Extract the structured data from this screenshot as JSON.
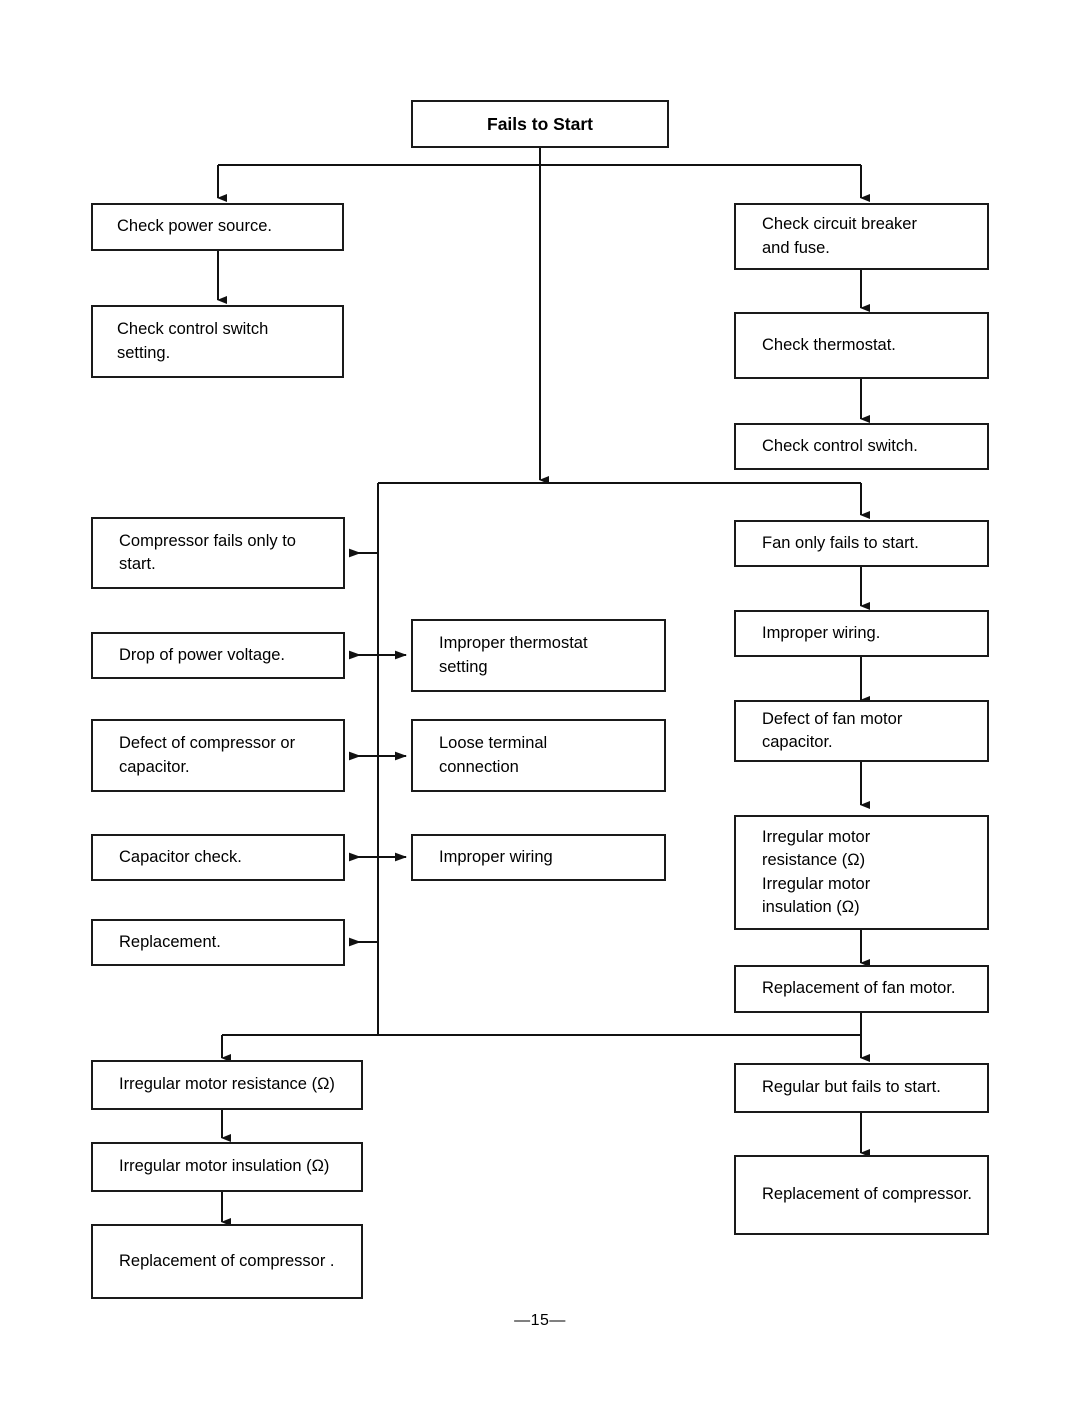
{
  "page": {
    "title": "Fails to Start",
    "page_number": "—15—",
    "line_color": "#1a1a1a",
    "box_border_color": "#1a1a1a",
    "background": "#ffffff",
    "text_color": "#000000"
  },
  "flowchart": {
    "root": {
      "id": "fails-to-start",
      "label": "Fails to Start"
    },
    "nodes": [
      {
        "id": "check-power-source",
        "label": "Check  power source."
      },
      {
        "id": "check-control-switch-setting",
        "label": "Check  control switch\nsetting."
      },
      {
        "id": "check-circuit-breaker-fuse",
        "label": "Check  circuit breaker\nand fuse."
      },
      {
        "id": "check-thermostat",
        "label": "Check  thermostat."
      },
      {
        "id": "check-control-switch",
        "label": "Check control switch."
      },
      {
        "id": "compressor-fails-only-to-start",
        "label": "Compressor fails only to\nstart."
      },
      {
        "id": "drop-of-power-voltage",
        "label": "Drop of power voltage."
      },
      {
        "id": "defect-of-compressor-capacitor",
        "label": "Defect of compressor or\ncapacitor."
      },
      {
        "id": "capacitor-check",
        "label": "Capacitor check."
      },
      {
        "id": "replacement",
        "label": "Replacement."
      },
      {
        "id": "improper-thermostat-setting",
        "label": "Improper thermostat\nsetting"
      },
      {
        "id": "loose-terminal-connection",
        "label": "Loose terminal\nconnection"
      },
      {
        "id": "improper-wiring-center",
        "label": "Improper wiring"
      },
      {
        "id": "fan-only-fails-to-start",
        "label": "Fan only fails to start."
      },
      {
        "id": "improper-wiring-right",
        "label": "Improper wiring."
      },
      {
        "id": "defect-of-fan-motor-capacitor",
        "label": "Defect of fan motor\ncapacitor."
      },
      {
        "id": "irregular-motor-resistance-insulation",
        "label": "Irregular motor\nresistance (Ω)\nIrregular motor\ninsulation (Ω)"
      },
      {
        "id": "replacement-of-fan-motor",
        "label": "Replacement of fan motor."
      },
      {
        "id": "irregular-motor-resistance",
        "label": "Irregular motor resistance (Ω)"
      },
      {
        "id": "irregular-motor-insulation",
        "label": "Irregular motor insulation (Ω)"
      },
      {
        "id": "replacement-of-compressor-left",
        "label": "Replacement of compressor ."
      },
      {
        "id": "regular-but-fails-to-start",
        "label": "Regular but fails to start."
      },
      {
        "id": "replacement-of-compressor-right",
        "label": "Replacement of compressor."
      }
    ]
  }
}
